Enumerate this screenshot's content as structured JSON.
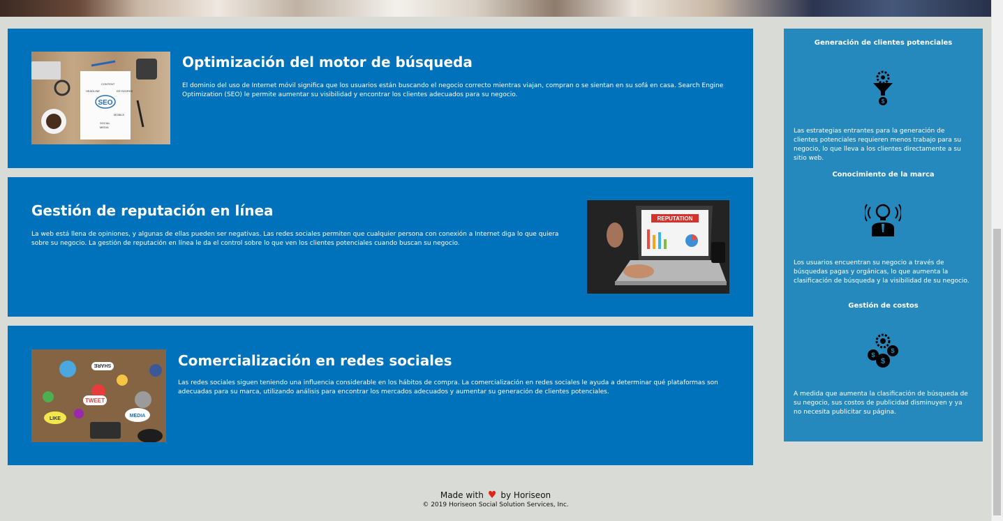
{
  "services": [
    {
      "title": "Optimización del motor de búsqueda",
      "text": "El dominio del uso de Internet móvil significa que los usuarios están buscando el negocio correcto mientras viajan, compran o se sientan en su sofá en casa. Search Engine Optimization (SEO) le permite aumentar su visibilidad y encontrar los clientes adecuados para su negocio.",
      "image_words": [
        "SEO",
        "CONTENT",
        "KEYWORDS",
        "HEADLINE",
        "MOBILE",
        "SOCIAL",
        "MEDIA"
      ]
    },
    {
      "title": "Gestión de reputación en línea",
      "text": "La web está llena de opiniones, y algunas de ellas pueden ser negativas. Las redes sociales permiten que cualquier persona con conexión a Internet diga lo que quiera sobre su negocio. La gestión de reputación en línea le da el control sobre lo que ven los clientes potenciales cuando buscan su negocio.",
      "image_words": [
        "REPUTATION"
      ]
    },
    {
      "title": "Comercialización en redes sociales",
      "text": "Las redes sociales siguen teniendo una influencia considerable en los hábitos de compra. La comercialización en redes sociales le ayuda a determinar qué plataformas son adecuadas para su marca, utilizando análisis para encontrar los mercados adecuados y aumentar su generación de clientes potenciales.",
      "image_words": [
        "SHARE",
        "TWEET",
        "LIKE",
        "MEDIA"
      ]
    }
  ],
  "benefits": [
    {
      "title": "Generación de clientes potenciales",
      "icon": "lead-funnel-icon",
      "text": "Las estrategias entrantes para la generación de clientes potenciales requieren menos trabajo para su negocio, lo que lleva a los clientes directamente a su sitio web."
    },
    {
      "title": "Conocimiento de la marca",
      "icon": "brand-lightbulb-icon",
      "text": "Los usuarios encuentran su negocio a través de búsquedas pagas y orgánicas, lo que aumenta la clasificación de búsqueda y la visibilidad de su negocio."
    },
    {
      "title": "Gestión de costos",
      "icon": "cost-coins-icon",
      "text": "A medida que aumenta la clasificación de búsqueda de su negocio, sus costos de publicidad disminuyen y ya no necesita publicitar su página."
    }
  ],
  "footer": {
    "made_prefix": "Made with",
    "made_suffix": "by Horiseon",
    "copyright": "© 2019 Horiseon Social Solution Services, Inc."
  },
  "colors": {
    "card_bg": "#0072bb",
    "aside_bg": "#2589bd",
    "page_bg": "#d9dcd6",
    "heart": "#e0231b"
  }
}
